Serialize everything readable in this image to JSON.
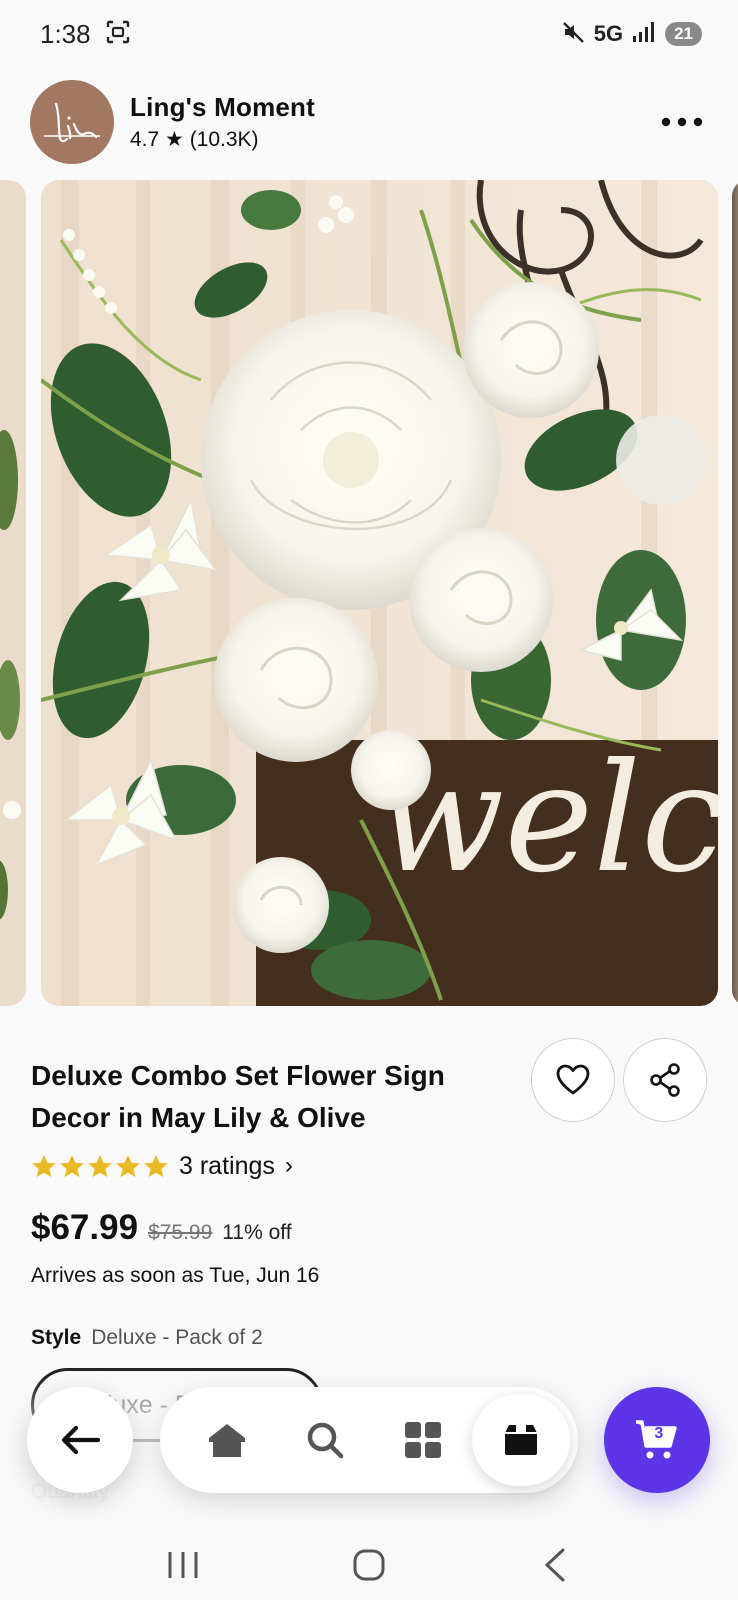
{
  "status_bar": {
    "time": "1:38",
    "network": "5G",
    "battery": "21",
    "icons": [
      "screenshot-icon",
      "mute-icon",
      "signal-icon"
    ]
  },
  "shop": {
    "name": "Ling's Moment",
    "rating": "4.7 ★ (10.3K)",
    "avatar_text": "li",
    "more_label": "..."
  },
  "product": {
    "image_sign_text": "welco",
    "title": "Deluxe Combo Set Flower Sign Decor in May Lily & Olive",
    "ratings_count": "3 ratings",
    "ratings_chevron": "›",
    "star_rating": 5,
    "price": "$67.99",
    "original_price": "$75.99",
    "discount": "11% off",
    "arrival": "Arrives as soon as Tue, Jun 16",
    "style_label": "Style",
    "style_value": "Deluxe - Pack of 2",
    "style_option": "Deluxe - Pack of 2",
    "quantity_label": "Quantity"
  },
  "nav": {
    "items": [
      "back-arrow-icon",
      "home-icon",
      "search-icon",
      "categories-icon",
      "box-icon"
    ],
    "cart_count": "3"
  },
  "colors": {
    "accent": "#5b35e6",
    "star": "#e8b923",
    "background": "#f9f9f9"
  }
}
